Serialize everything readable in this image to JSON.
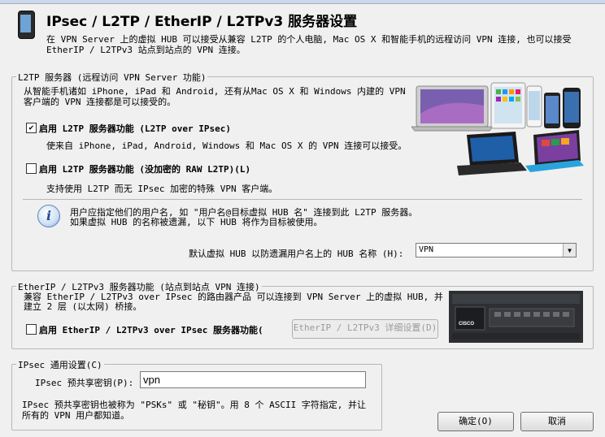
{
  "window": {
    "title": "IPsec / L2TP / EtherIP / L2TPv3 服务器设置",
    "description": "在 VPN Server 上的虚拟 HUB 可以接受从兼容 L2TP 的个人电脑, Mac OS X 和智能手机的远程访问 VPN 连接, 也可以接受\nEtherIP / L2TPv3 站点到站点的 VPN 连接。"
  },
  "l2tp": {
    "group_label": "L2TP 服务器 (远程访问 VPN Server 功能)",
    "intro": "从智能手机诸如 iPhone, iPad 和 Android, 还有从Mac OS X 和 Windows 内建的 VPN\n客户端的 VPN 连接都是可以接受的。",
    "opt_ipsec_label": "启用 L2TP 服务器功能 (L2TP over IPsec)",
    "opt_ipsec_checked": true,
    "opt_ipsec_check_glyph": "✔",
    "opt_ipsec_desc": "使来自 iPhone, iPad, Android, Windows 和 Mac OS X 的 VPN 连接可以接受。",
    "opt_raw_label": "启用 L2TP 服务器功能 (没加密的 RAW L2TP)(L)",
    "opt_raw_checked": false,
    "opt_raw_desc": "支持使用 L2TP 而无 IPsec 加密的特殊 VPN 客户端。",
    "info_text": "用户应指定他们的用户名, 如 \"用户名@目标虚拟 HUB 名\" 连接到此 L2TP 服务器。\n如果虚拟 HUB 的名称被遗漏, 以下 HUB 将作为目标被使用。",
    "default_hub_label": "默认虚拟 HUB 以防遗漏用户名上的 HUB 名称 (H):",
    "default_hub_value": "VPN"
  },
  "etherip": {
    "group_label": "EtherIP / L2TPv3 服务器功能 (站点到站点 VPN 连接)",
    "intro": "兼容 EtherIP / L2TPv3 over IPsec 的路由器产品 可以连接到 VPN Server 上的虚拟 HUB, 并\n建立 2 层 (以太网) 桥接。",
    "opt_label": "启用 EtherIP / L2TPv3 over IPsec 服务器功能(",
    "opt_checked": false,
    "detail_button": "EtherIP / L2TPv3 详细设置(D)",
    "router_brand": "CISCO"
  },
  "ipsec": {
    "group_label": "IPsec 通用设置(C)",
    "psk_label": "IPsec 预共享密钥(P):",
    "psk_value": "vpn",
    "psk_note": "IPsec 预共享密钥也被称为 \"PSKs\" 或 \"秘钥\"。用 8 个 ASCII 字符指定, 并让\n所有的 VPN 用户都知道。"
  },
  "buttons": {
    "ok": "确定(O)",
    "cancel": "取消"
  },
  "icons": {
    "info": "info-icon",
    "dropdown": "chevron-down-icon",
    "phone": "phone-icon"
  },
  "colors": {
    "background": "#f0f0f0",
    "group_border": "#b8b8b8",
    "router_body": "#2d2f33"
  }
}
